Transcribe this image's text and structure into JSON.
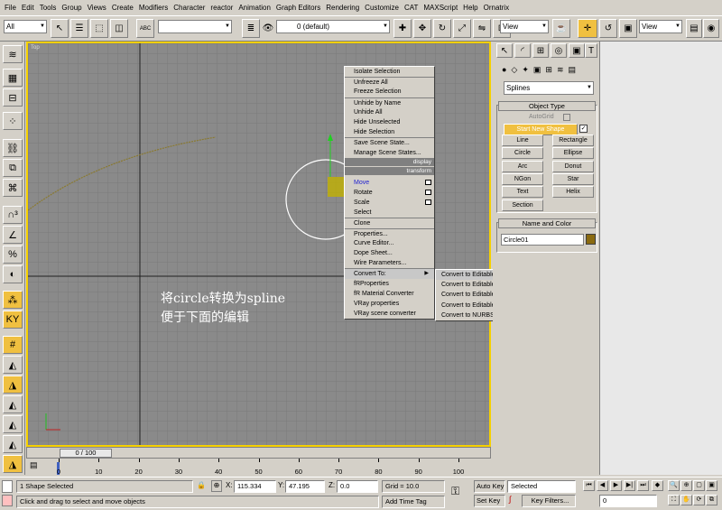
{
  "menubar": [
    "File",
    "Edit",
    "Tools",
    "Group",
    "Views",
    "Create",
    "Modifiers",
    "Character",
    "reactor",
    "Animation",
    "Graph Editors",
    "Rendering",
    "Customize",
    "CAT",
    "MAXScript",
    "Help",
    "Ornatrix"
  ],
  "toolbar": {
    "selection_filter": "All",
    "named_selection": "",
    "layer": "0 (default)",
    "ref_coord": "View",
    "render_view": "View"
  },
  "viewport": {
    "label": "Top",
    "annotation_line1": "将circle转换为spline",
    "annotation_line2": "便于下面的编辑"
  },
  "context_menu": {
    "items_top": [
      "Isolate Selection",
      "Unfreeze All",
      "Freeze Selection",
      "Unhide by Name",
      "Unhide All",
      "Hide Unselected",
      "Hide Selection",
      "Save Scene State...",
      "Manage Scene States..."
    ],
    "header_display": "display",
    "header_transform": "transform",
    "transform_items": [
      "Move",
      "Rotate",
      "Scale",
      "Select",
      "Clone",
      "Properties...",
      "Curve Editor...",
      "Dope Sheet...",
      "Wire Parameters...",
      "Convert To:",
      "fRProperties",
      "fR Material Converter",
      "VRay properties",
      "VRay scene converter"
    ]
  },
  "submenu": [
    "Convert to Editable Spline",
    "Convert to Editable Mesh",
    "Convert to Editable Poly",
    "Convert to Editable Patch",
    "Convert to NURBS"
  ],
  "command_panel": {
    "category_dropdown": "Splines",
    "object_type_title": "Object Type",
    "autogrid_label": "AutoGrid",
    "start_new_shape_label": "Start New Shape",
    "buttons": [
      "Line",
      "Rectangle",
      "Circle",
      "Ellipse",
      "Arc",
      "Donut",
      "NGon",
      "Star",
      "Text",
      "Helix",
      "Section"
    ],
    "name_color_title": "Name and Color",
    "object_name": "Circle01",
    "object_color": "#8a6a10"
  },
  "timeline": {
    "slider_label": "0 / 100",
    "ticks": [
      "0",
      "10",
      "20",
      "30",
      "40",
      "50",
      "60",
      "70",
      "80",
      "90",
      "100"
    ]
  },
  "statusbar": {
    "selection": "1 Shape Selected",
    "prompt": "Click and drag to select and move objects",
    "x_label": "X:",
    "x_value": "115.334",
    "y_label": "Y:",
    "y_value": "47.195",
    "z_label": "Z:",
    "z_value": "0.0",
    "grid": "Grid = 10.0",
    "add_time_tag": "Add Time Tag",
    "auto_key": "Auto Key",
    "key_mode": "Selected",
    "set_key": "Set Key",
    "key_filters": "Key Filters...",
    "frame": "0"
  }
}
